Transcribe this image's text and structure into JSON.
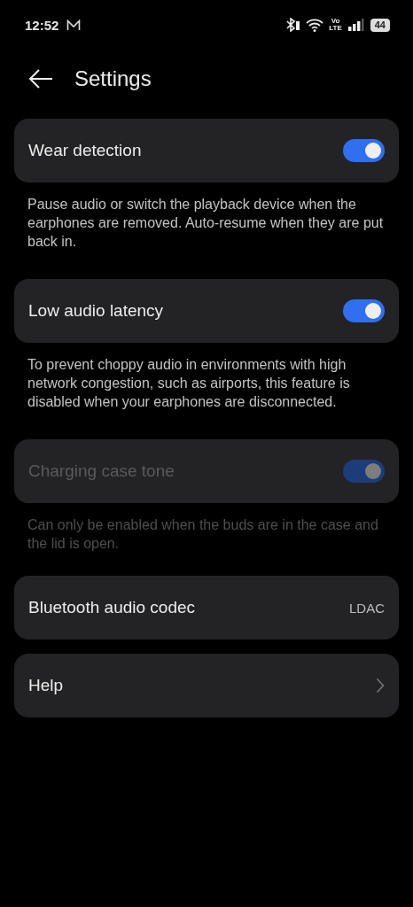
{
  "status_bar": {
    "time": "12:52",
    "network_label": "Vo\nLTE",
    "battery": "44"
  },
  "header": {
    "title": "Settings"
  },
  "items": [
    {
      "kind": "toggle",
      "label": "Wear detection",
      "on": true,
      "disabled": false,
      "description": "Pause audio or switch the playback device when the earphones are removed. Auto-resume when they are put back in."
    },
    {
      "kind": "toggle",
      "label": "Low audio latency",
      "on": true,
      "disabled": false,
      "description": "To prevent choppy audio in environments with high network congestion, such as airports, this feature is disabled when your earphones are disconnected."
    },
    {
      "kind": "toggle",
      "label": "Charging case tone",
      "on": true,
      "disabled": true,
      "description": "Can only be enabled when the buds are in the case and the lid is open."
    },
    {
      "kind": "value",
      "label": "Bluetooth audio codec",
      "value": "LDAC"
    },
    {
      "kind": "link",
      "label": "Help"
    }
  ]
}
